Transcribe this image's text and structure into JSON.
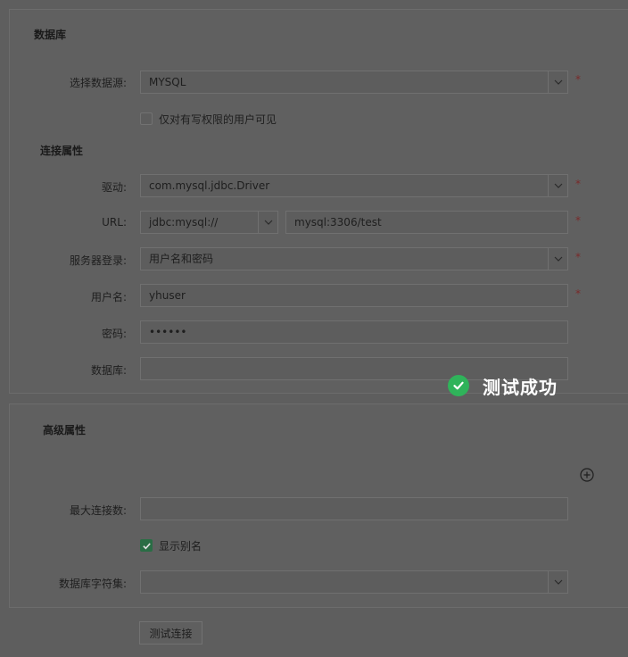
{
  "db_section": {
    "title": "数据库",
    "datasource_label": "选择数据源:",
    "datasource_value": "MYSQL",
    "write_only_label": "仅对有写权限的用户可见",
    "conn_title": "连接属性",
    "driver_label": "驱动:",
    "driver_value": "com.mysql.jdbc.Driver",
    "url_label": "URL:",
    "url_prefix": "jdbc:mysql://",
    "url_host": "mysql:3306/test",
    "login_label": "服务器登录:",
    "login_value": "用户名和密码",
    "user_label": "用户名:",
    "user_value": "yhuser",
    "pwd_label": "密码:",
    "pwd_value": "••••••",
    "database_label": "数据库:",
    "database_value": "",
    "required_mark": "*"
  },
  "advanced": {
    "title": "高级属性",
    "maxconn_label": "最大连接数:",
    "maxconn_value": "",
    "alias_label": "显示别名",
    "alias_checked": true,
    "charset_label": "数据库字符集:",
    "charset_value": ""
  },
  "actions": {
    "test_button": "测试连接"
  },
  "toast": {
    "message": "测试成功"
  },
  "colors": {
    "success": "#2fb35a",
    "required": "#7a2a2a"
  }
}
